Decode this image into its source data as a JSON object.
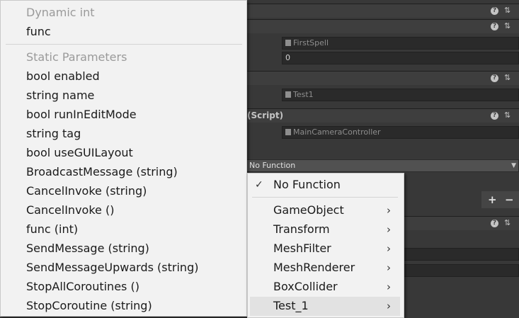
{
  "inspector": {
    "component_header_title": "(Script)",
    "field_firstspell": "FirstSpell",
    "field_zero": "0",
    "field_test1": "Test1",
    "field_maincamera": "MainCameraController",
    "function_dropdown_value": "No Function",
    "add_label": "+",
    "remove_label": "−",
    "help_glyph": "?",
    "settings_glyph": "⇅"
  },
  "left_menu": {
    "dynamic_header": "Dynamic int",
    "dynamic_items": [
      "func"
    ],
    "static_header": "Static Parameters",
    "static_items": [
      "bool enabled",
      "string name",
      "bool runInEditMode",
      "string tag",
      "bool useGUILayout",
      "BroadcastMessage (string)",
      "CancelInvoke (string)",
      "CancelInvoke ()",
      "func (int)",
      "SendMessage (string)",
      "SendMessageUpwards (string)",
      "StopAllCoroutines ()",
      "StopCoroutine (string)"
    ]
  },
  "right_menu": {
    "selected_item": "No Function",
    "check_glyph": "✓",
    "submenu_arrow": "›",
    "items": [
      "GameObject",
      "Transform",
      "MeshFilter",
      "MeshRenderer",
      "BoxCollider",
      "Test_1"
    ]
  },
  "colors": {
    "inspector_bg": "#383838",
    "menu_bg": "#f2f2f2",
    "menu_hover": "#e2e2e2",
    "disabled_text": "#9a9a9a"
  }
}
